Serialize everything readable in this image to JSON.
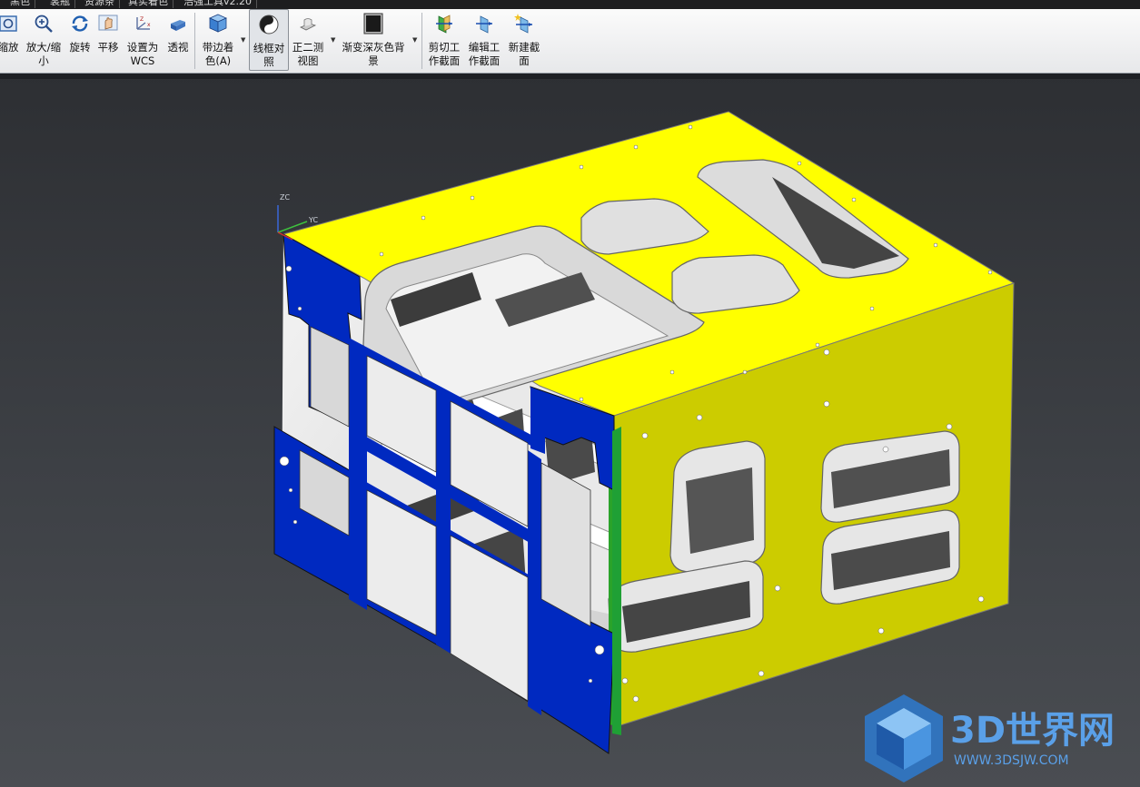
{
  "tabs": [
    "黑色",
    "裳瓶",
    "资源条",
    "真实着色",
    "浩强工具v2.20"
  ],
  "toolbar": {
    "buttons": [
      {
        "id": "shrink",
        "line1": "缩放",
        "line2": "",
        "icon": "zoom-fit-icon"
      },
      {
        "id": "zoom",
        "line1": "放大/缩",
        "line2": "小",
        "icon": "zoom-in-icon"
      },
      {
        "id": "rotate",
        "line1": "旋转",
        "line2": "",
        "icon": "rotate-icon"
      },
      {
        "id": "pan",
        "line1": "平移",
        "line2": "",
        "icon": "pan-icon"
      },
      {
        "id": "wcs",
        "line1": "设置为",
        "line2": "WCS",
        "icon": "wcs-icon"
      },
      {
        "id": "perspective",
        "line1": "透视",
        "line2": "",
        "icon": "perspective-icon"
      },
      {
        "id": "shaded_edges",
        "line1": "带边着",
        "line2": "色(A)",
        "icon": "shaded-cube-icon"
      },
      {
        "id": "wireframe",
        "line1": "线框对",
        "line2": "照",
        "icon": "wireframe-icon"
      },
      {
        "id": "dimetric",
        "line1": "正二测",
        "line2": "视图",
        "icon": "dimetric-view-icon"
      },
      {
        "id": "gradient_bg",
        "line1": "渐变深灰色背",
        "line2": "景",
        "icon": "gradient-background-icon"
      },
      {
        "id": "clip_section",
        "line1": "剪切工",
        "line2": "作截面",
        "icon": "clip-section-icon"
      },
      {
        "id": "edit_section",
        "line1": "编辑工",
        "line2": "作截面",
        "icon": "edit-section-icon"
      },
      {
        "id": "new_section",
        "line1": "新建截",
        "line2": "面",
        "icon": "new-section-icon"
      }
    ]
  },
  "triad": {
    "zc": "ZC",
    "yc": "YC"
  },
  "watermark": {
    "title": "3D世界网",
    "url": "WWW.3DSJW.COM"
  },
  "colors": {
    "top_face": "#ffff00",
    "front_face": "#cccc00",
    "side_face": "#0029c0",
    "interior": "#ffffff",
    "edge_strip": "#22aa22"
  }
}
